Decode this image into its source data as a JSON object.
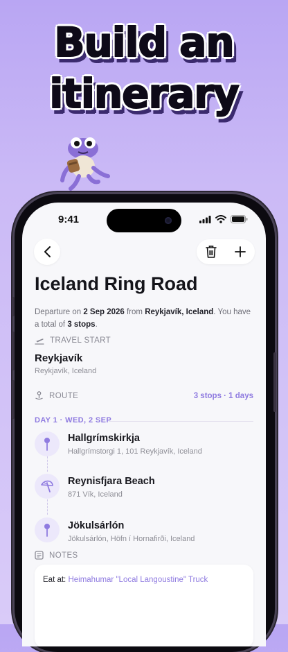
{
  "headline": {
    "line1": "Build an",
    "line2": "itinerary"
  },
  "status_bar": {
    "time": "9:41"
  },
  "trip": {
    "title": "Iceland Ring Road",
    "description": {
      "p1": "Departure on ",
      "date": "2 Sep 2026",
      "p2": " from ",
      "place": "Reykjavík, Iceland",
      "p3": ". You have a total of ",
      "count": "3 stops",
      "p4": "."
    }
  },
  "travel_start": {
    "label": "TRAVEL START",
    "name": "Reykjavík",
    "address": "Reykjavík, Iceland"
  },
  "route": {
    "label": "ROUTE",
    "summary": "3 stops · 1 days",
    "day_label": "DAY 1 · WED, 2 SEP",
    "stops": [
      {
        "name": "Hallgrímskirkja",
        "address": "Hallgrímstorgi 1, 101 Reykjavík, Iceland",
        "icon": "pin-icon"
      },
      {
        "name": "Reynisfjara Beach",
        "address": "871 Vík, Iceland",
        "icon": "beach-umbrella-icon"
      },
      {
        "name": "Jökulsárlón",
        "address": "Jökulsárlón, Höfn í Hornafirði, Iceland",
        "icon": "pin-icon"
      }
    ]
  },
  "notes": {
    "label": "NOTES",
    "prefix": "Eat at: ",
    "link": "Heimahumar \"Local Langoustine\" Truck"
  },
  "colors": {
    "accent": "#8f7be0",
    "background": "#b9a6f3",
    "icon_bg": "#ece8fb"
  }
}
